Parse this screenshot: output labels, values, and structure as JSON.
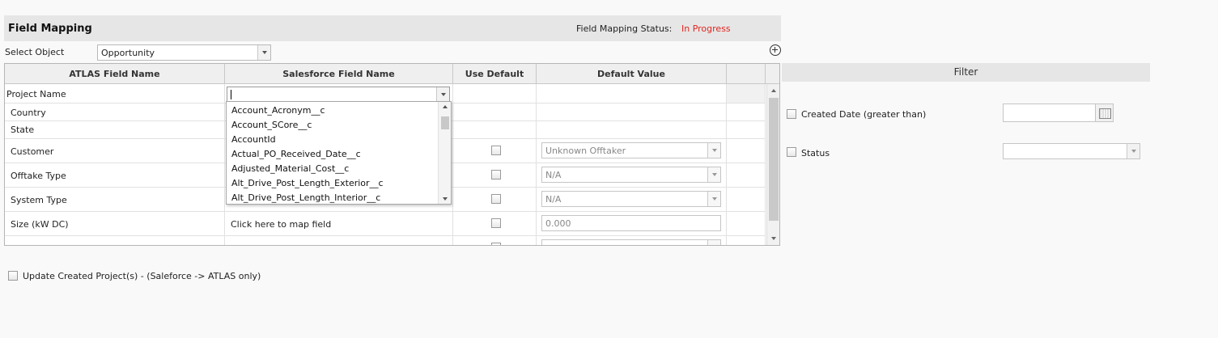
{
  "header": {
    "title": "Field Mapping",
    "status_label": "Field Mapping Status:",
    "status_value": "In Progress",
    "status_color": "#e0261f"
  },
  "select_object": {
    "label": "Select Object",
    "value": "Opportunity"
  },
  "grid": {
    "columns": [
      "ATLAS Field Name",
      "Salesforce Field Name",
      "Use Default",
      "Default Value"
    ],
    "rows": [
      {
        "atlas": "Project Name",
        "salesforce": "",
        "use_default": null,
        "default": null
      },
      {
        "atlas": "Country",
        "salesforce": "",
        "use_default": null,
        "default": null
      },
      {
        "atlas": "State",
        "salesforce": "",
        "use_default": null,
        "default": null
      },
      {
        "atlas": "Customer",
        "salesforce": "",
        "use_default": false,
        "default": "Unknown Offtaker",
        "default_type": "select"
      },
      {
        "atlas": "Offtake Type",
        "salesforce": "",
        "use_default": false,
        "default": "N/A",
        "default_type": "select"
      },
      {
        "atlas": "System Type",
        "salesforce": "",
        "use_default": false,
        "default": "N/A",
        "default_type": "select"
      },
      {
        "atlas": "Size (kW DC)",
        "salesforce": "Click here to map field",
        "use_default": false,
        "default": "0.000",
        "default_type": "input"
      }
    ]
  },
  "salesforce_dropdown": {
    "options": [
      "Account_Acronym__c",
      "Account_SCore__c",
      "AccountId",
      "Actual_PO_Received_Date__c",
      "Adjusted_Material_Cost__c",
      "Alt_Drive_Post_Length_Exterior__c",
      "Alt_Drive_Post_Length_Interior__c"
    ]
  },
  "filter": {
    "title": "Filter",
    "created_date_label": "Created Date (greater than)",
    "created_date_value": "",
    "status_label": "Status",
    "status_value": ""
  },
  "footer": {
    "update_label": "Update Created Project(s) - (Saleforce -> ATLAS only)"
  }
}
